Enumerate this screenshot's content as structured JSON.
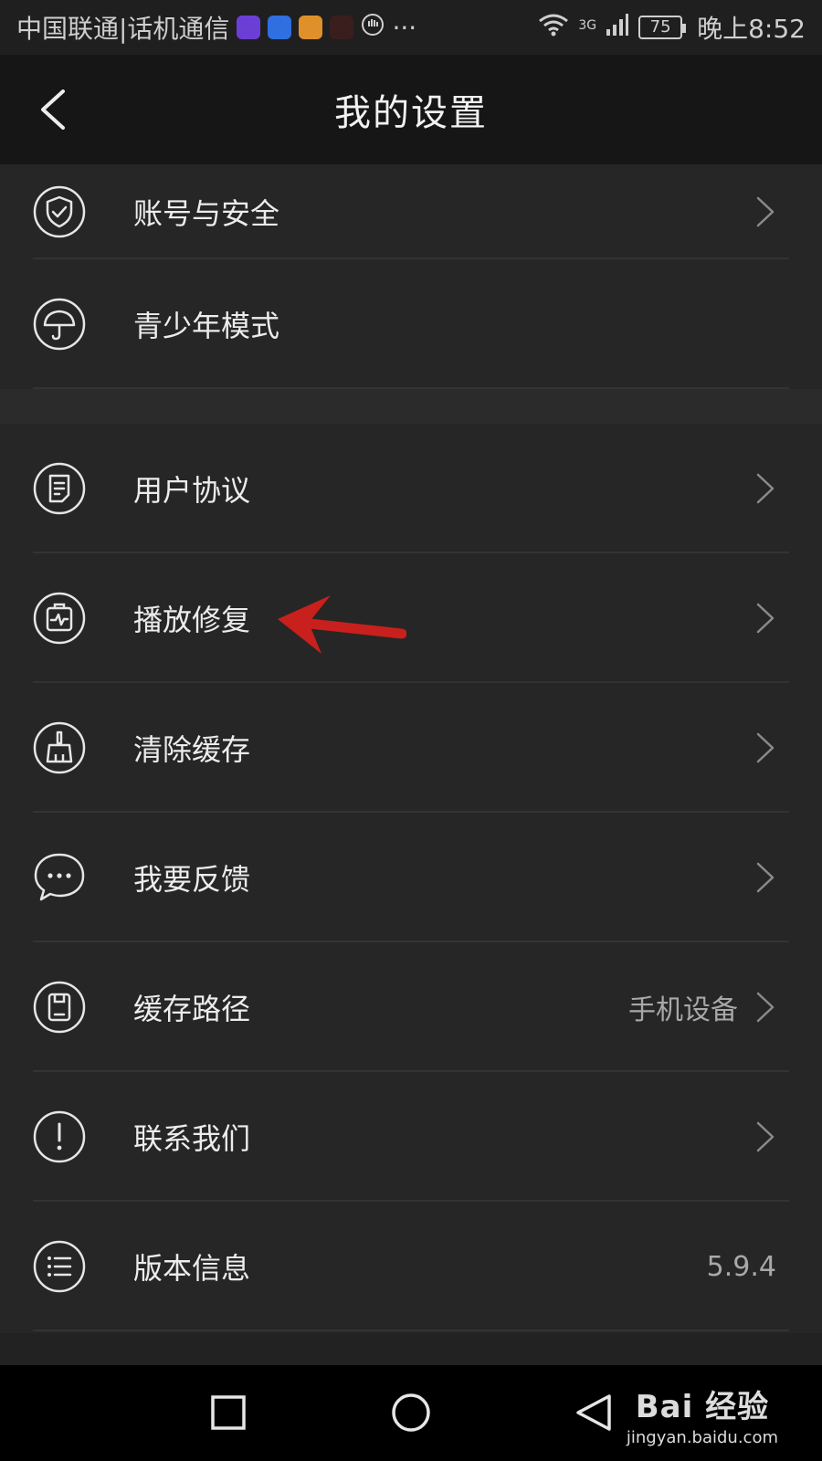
{
  "status_bar": {
    "carrier": "中国联通|话机通信",
    "signal_type": "3G",
    "battery": "75",
    "time": "晚上8:52",
    "more": "···",
    "badge_colors": [
      "#6b3fd6",
      "#2f6fe0",
      "#e0902a",
      "#c8262c"
    ]
  },
  "header": {
    "title": "我的设置",
    "back_icon": "chevron-left-icon"
  },
  "settings": {
    "group1": [
      {
        "label": "账号与安全",
        "icon": "shield-check-icon",
        "value": "",
        "has_chevron": true
      },
      {
        "label": "青少年模式",
        "icon": "umbrella-icon",
        "value": "",
        "has_chevron": false
      }
    ],
    "group2": [
      {
        "label": "用户协议",
        "icon": "document-icon",
        "value": "",
        "has_chevron": true
      },
      {
        "label": "播放修复",
        "icon": "repair-kit-icon",
        "value": "",
        "has_chevron": true
      },
      {
        "label": "清除缓存",
        "icon": "broom-icon",
        "value": "",
        "has_chevron": true
      },
      {
        "label": "我要反馈",
        "icon": "chat-bubble-icon",
        "value": "",
        "has_chevron": true
      },
      {
        "label": "缓存路径",
        "icon": "phone-storage-icon",
        "value": "手机设备",
        "has_chevron": true
      },
      {
        "label": "联系我们",
        "icon": "exclamation-icon",
        "value": "",
        "has_chevron": true
      },
      {
        "label": "版本信息",
        "icon": "list-icon",
        "value": "5.9.4",
        "has_chevron": false
      }
    ]
  },
  "nav_bar": {
    "buttons": [
      "recents-square-icon",
      "home-circle-icon",
      "back-triangle-icon"
    ]
  },
  "watermark": {
    "brand": "Bai 经验",
    "url": "jingyan.baidu.com"
  },
  "colors": {
    "background": "#222222",
    "header": "#161616",
    "annotation_arrow": "#c8201c"
  }
}
